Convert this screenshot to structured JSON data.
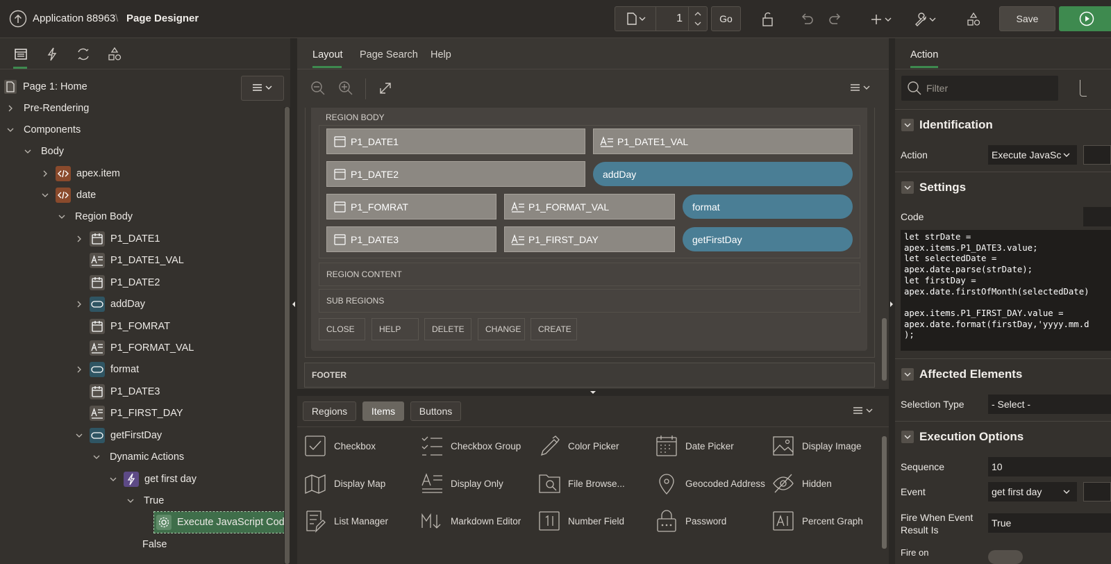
{
  "header": {
    "app_name": "Application 88963",
    "separator": "\\",
    "page_title": "Page Designer",
    "page_number": "1",
    "go_label": "Go",
    "save_label": "Save"
  },
  "tree": {
    "page": "Page 1: Home",
    "items": [
      {
        "label": "Pre-Rendering"
      },
      {
        "label": "Components"
      },
      {
        "label": "Body"
      },
      {
        "label": "apex.item"
      },
      {
        "label": "date"
      },
      {
        "label": "Region Body"
      },
      {
        "label": "P1_DATE1"
      },
      {
        "label": "P1_DATE1_VAL"
      },
      {
        "label": "P1_DATE2"
      },
      {
        "label": "addDay"
      },
      {
        "label": "P1_FOMRAT"
      },
      {
        "label": "P1_FORMAT_VAL"
      },
      {
        "label": "format"
      },
      {
        "label": "P1_DATE3"
      },
      {
        "label": "P1_FIRST_DAY"
      },
      {
        "label": "getFirstDay"
      },
      {
        "label": "Dynamic Actions"
      },
      {
        "label": "get first day"
      },
      {
        "label": "True"
      },
      {
        "label": "Execute JavaScript Code"
      },
      {
        "label": "False"
      }
    ]
  },
  "center": {
    "tabs": [
      "Layout",
      "Page Search",
      "Help"
    ],
    "region_body_label": "REGION BODY",
    "items": {
      "date1": "P1_DATE1",
      "date1_val": "P1_DATE1_VAL",
      "date2": "P1_DATE2",
      "addday": "addDay",
      "fomrat": "P1_FOMRAT",
      "format_val": "P1_FORMAT_VAL",
      "format": "format",
      "date3": "P1_DATE3",
      "first_day": "P1_FIRST_DAY",
      "getfirstday": "getFirstDay"
    },
    "region_content": "REGION CONTENT",
    "sub_regions": "SUB REGIONS",
    "region_buttons": [
      "CLOSE",
      "HELP",
      "DELETE",
      "CHANGE",
      "CREATE"
    ],
    "footer": "FOOTER",
    "gallery_tabs": [
      "Regions",
      "Items",
      "Buttons"
    ],
    "gallery": [
      "Checkbox",
      "Checkbox Group",
      "Color Picker",
      "Date Picker",
      "Display Image",
      "Display Map",
      "Display Only",
      "File Browse...",
      "Geocoded Address",
      "Hidden",
      "List Manager",
      "Markdown Editor",
      "Number Field",
      "Password",
      "Percent Graph"
    ]
  },
  "properties": {
    "tab": "Action",
    "filter_placeholder": "Filter",
    "sections": {
      "identification": "Identification",
      "settings": "Settings",
      "affected": "Affected Elements",
      "execution": "Execution Options"
    },
    "action_label": "Action",
    "action_value": "Execute JavaSc",
    "code_label": "Code",
    "code": "let strDate =\napex.items.P1_DATE3.value;\nlet selectedDate =\napex.date.parse(strDate);\nlet firstDay =\napex.date.firstOfMonth(selectedDate)\n\napex.items.P1_FIRST_DAY.value =\napex.date.format(firstDay,'yyyy.mm.d\n);",
    "selection_type_label": "Selection Type",
    "selection_type_value": "- Select -",
    "sequence_label": "Sequence",
    "sequence_value": "10",
    "event_label": "Event",
    "event_value": "get first day",
    "fire_when_label": "Fire When Event Result Is",
    "fire_when_value": "True",
    "fire_on_label": "Fire on"
  },
  "colors": {
    "accent_green": "#3e8a4f",
    "button_blue": "#4a7e95",
    "item_gray": "#8c8882",
    "selected_node": "#3f6e4a"
  }
}
